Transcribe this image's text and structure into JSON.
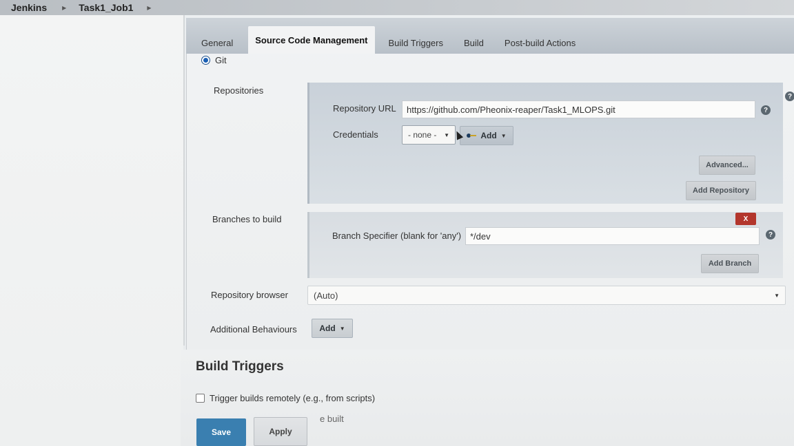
{
  "breadcrumb": {
    "app": "Jenkins",
    "job": "Task1_Job1"
  },
  "tabs": [
    {
      "label": "General"
    },
    {
      "label": "Source Code Management"
    },
    {
      "label": "Build Triggers"
    },
    {
      "label": "Build"
    },
    {
      "label": "Post-build Actions"
    }
  ],
  "scm": {
    "git_label": "Git",
    "repositories_label": "Repositories",
    "repo_url_label": "Repository URL",
    "repo_url_value": "https://github.com/Pheonix-reaper/Task1_MLOPS.git",
    "credentials_label": "Credentials",
    "credentials_value": "- none -",
    "add_label": "Add",
    "advanced_label": "Advanced...",
    "add_repository_label": "Add Repository",
    "branches_label": "Branches to build",
    "delete_branch_label": "X",
    "branch_specifier_label": "Branch Specifier (blank for 'any')",
    "branch_specifier_value": "*/dev",
    "add_branch_label": "Add Branch",
    "repo_browser_label": "Repository browser",
    "repo_browser_value": "(Auto)",
    "additional_behaviours_label": "Additional Behaviours",
    "additional_add_label": "Add"
  },
  "build_triggers": {
    "title": "Build Triggers",
    "trigger_remote_label": "Trigger builds remotely (e.g., from scripts)",
    "partial_text": "e built"
  },
  "actions": {
    "save_label": "Save",
    "apply_label": "Apply"
  },
  "help_glyph": "?",
  "colors": {
    "save_button": "#3a7fb0",
    "delete_button": "#b3362c",
    "radio_selected": "#1a5fb4"
  }
}
